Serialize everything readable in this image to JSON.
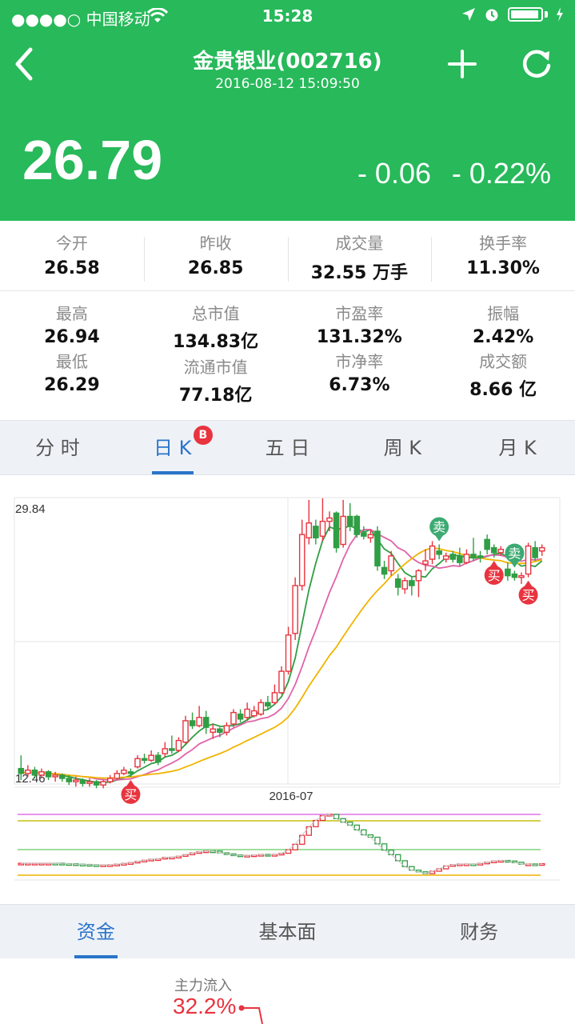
{
  "status": {
    "carrier": "●●●●○ 中国移动",
    "time": "15:28"
  },
  "header": {
    "title": "金贵银业(002716)",
    "subtitle": "2016-08-12 15:09:50",
    "price": "26.79",
    "change": "- 0.06",
    "change_pct": "- 0.22%",
    "bg_color": "#27b95a"
  },
  "stats_row1": [
    {
      "label": "今开",
      "value": "26.58"
    },
    {
      "label": "昨收",
      "value": "26.85"
    },
    {
      "label": "成交量",
      "value": "32.55 万手"
    },
    {
      "label": "换手率",
      "value": "11.30%"
    }
  ],
  "stats_row2": [
    {
      "label1": "最高",
      "value1": "26.94",
      "label2": "最低",
      "value2": "26.29"
    },
    {
      "label1": "总市值",
      "value1": "134.83亿",
      "label2": "流通市值",
      "value2": "77.18亿"
    },
    {
      "label1": "市盈率",
      "value1": "131.32%",
      "label2": "市净率",
      "value2": "6.73%"
    },
    {
      "label1": "振幅",
      "value1": "2.42%",
      "label2": "成交额",
      "value2": "8.66 亿"
    }
  ],
  "tabs": [
    {
      "label": "分 时"
    },
    {
      "label": "日 K",
      "badge": "B"
    },
    {
      "label": "五 日"
    },
    {
      "label": "周 K"
    },
    {
      "label": "月 K"
    }
  ],
  "chart_data": {
    "type": "candlestick",
    "ymax_label": "29.84",
    "ymin_label": "12.46",
    "ylim": [
      12.46,
      29.84
    ],
    "x_label": "2016-07",
    "candles": [
      [
        13.4,
        13.1,
        14.2,
        12.7
      ],
      [
        13.1,
        13.3,
        13.6,
        12.9
      ],
      [
        13.3,
        13.0,
        13.5,
        12.8
      ],
      [
        13.0,
        13.2,
        13.4,
        12.8
      ],
      [
        13.2,
        12.9,
        13.3,
        12.7
      ],
      [
        12.9,
        13.0,
        13.2,
        12.6
      ],
      [
        13.0,
        12.8,
        13.1,
        12.6
      ],
      [
        12.8,
        12.6,
        13.0,
        12.4
      ],
      [
        12.6,
        12.7,
        12.9,
        12.3
      ],
      [
        12.7,
        12.5,
        12.8,
        12.3
      ],
      [
        12.5,
        12.6,
        12.8,
        12.3
      ],
      [
        12.6,
        12.4,
        12.7,
        12.2
      ],
      [
        12.4,
        12.6,
        12.7,
        12.2
      ],
      [
        12.6,
        12.8,
        13.0,
        12.5
      ],
      [
        12.8,
        13.1,
        13.3,
        12.7
      ],
      [
        13.1,
        13.3,
        13.5,
        13.0
      ],
      [
        13.2,
        13.1,
        13.4,
        12.9
      ],
      [
        13.5,
        14.0,
        14.2,
        13.4
      ],
      [
        14.0,
        13.9,
        14.3,
        13.7
      ],
      [
        13.9,
        14.2,
        14.5,
        13.8
      ],
      [
        14.2,
        13.8,
        14.4,
        13.6
      ],
      [
        14.3,
        14.6,
        15.0,
        14.1
      ],
      [
        14.6,
        14.5,
        15.4,
        14.3
      ],
      [
        14.5,
        15.1,
        15.3,
        14.4
      ],
      [
        15.0,
        16.3,
        16.6,
        14.9
      ],
      [
        16.3,
        16.0,
        16.8,
        15.8
      ],
      [
        16.0,
        16.5,
        17.2,
        15.9
      ],
      [
        16.5,
        15.9,
        16.9,
        15.5
      ],
      [
        15.6,
        15.8,
        16.1,
        15.2
      ],
      [
        15.8,
        15.6,
        15.9,
        15.3
      ],
      [
        15.6,
        16.0,
        16.2,
        15.4
      ],
      [
        16.1,
        16.8,
        17.0,
        15.9
      ],
      [
        16.7,
        16.4,
        17.0,
        16.2
      ],
      [
        16.5,
        17.0,
        17.4,
        16.3
      ],
      [
        16.6,
        16.9,
        17.2,
        16.5
      ],
      [
        16.7,
        17.4,
        17.6,
        16.6
      ],
      [
        17.4,
        17.2,
        17.8,
        17.0
      ],
      [
        17.4,
        18.0,
        18.5,
        17.3
      ],
      [
        18.0,
        19.3,
        19.6,
        17.9
      ],
      [
        19.3,
        21.5,
        22.0,
        19.1
      ],
      [
        21.6,
        24.5,
        25.0,
        21.2
      ],
      [
        24.5,
        27.6,
        28.5,
        24.2
      ],
      [
        27.4,
        28.3,
        29.7,
        27.0
      ],
      [
        28.1,
        27.4,
        28.5,
        27.0
      ],
      [
        27.5,
        28.4,
        29.8,
        27.2
      ],
      [
        28.4,
        28.6,
        29.0,
        27.8
      ],
      [
        28.9,
        26.8,
        29.0,
        26.5
      ],
      [
        27.0,
        28.7,
        29.7,
        26.8
      ],
      [
        28.7,
        28.1,
        29.5,
        27.8
      ],
      [
        28.7,
        27.6,
        28.8,
        27.4
      ],
      [
        27.7,
        27.5,
        28.1,
        27.3
      ],
      [
        27.4,
        27.6,
        27.9,
        27.1
      ],
      [
        27.8,
        25.7,
        28.1,
        25.4
      ],
      [
        25.6,
        25.2,
        26.0,
        24.9
      ],
      [
        25.4,
        26.3,
        26.6,
        25.1
      ],
      [
        24.9,
        24.4,
        25.2,
        23.9
      ],
      [
        24.3,
        24.8,
        25.0,
        24.0
      ],
      [
        24.8,
        24.5,
        25.0,
        23.9
      ],
      [
        24.8,
        25.4,
        25.5,
        23.8
      ],
      [
        25.8,
        26.0,
        26.7,
        25.4
      ],
      [
        26.1,
        26.9,
        27.2,
        25.8
      ],
      [
        26.6,
        26.4,
        27.0,
        26.1
      ],
      [
        26.1,
        26.3,
        26.5,
        25.9
      ],
      [
        26.4,
        26.1,
        26.6,
        25.9
      ],
      [
        26.3,
        25.9,
        26.8,
        25.7
      ],
      [
        25.9,
        26.4,
        26.7,
        25.8
      ],
      [
        26.4,
        26.2,
        27.4,
        26.0
      ],
      [
        26.3,
        26.2,
        26.6,
        25.9
      ],
      [
        27.3,
        26.7,
        27.6,
        26.4
      ],
      [
        26.8,
        26.5,
        27.0,
        26.2
      ],
      [
        26.5,
        26.7,
        26.9,
        26.3
      ],
      [
        25.5,
        25.1,
        25.9,
        24.8
      ],
      [
        25.2,
        25.0,
        25.4,
        24.8
      ],
      [
        25.0,
        25.1,
        25.3,
        24.6
      ],
      [
        25.2,
        26.9,
        27.1,
        25.0
      ],
      [
        26.8,
        26.2,
        27.2,
        26.0
      ],
      [
        26.6,
        26.8,
        27.0,
        26.3
      ]
    ],
    "markers": [
      {
        "label": "买",
        "index": 16
      },
      {
        "label": "卖",
        "index": 61
      },
      {
        "label": "买",
        "index": 69
      },
      {
        "label": "卖",
        "index": 72
      },
      {
        "label": "买",
        "index": 74
      }
    ]
  },
  "bottom_tabs": [
    {
      "label": "资金"
    },
    {
      "label": "基本面"
    },
    {
      "label": "财务"
    }
  ],
  "fund": {
    "label": "主力流入",
    "value": "32.2%"
  }
}
